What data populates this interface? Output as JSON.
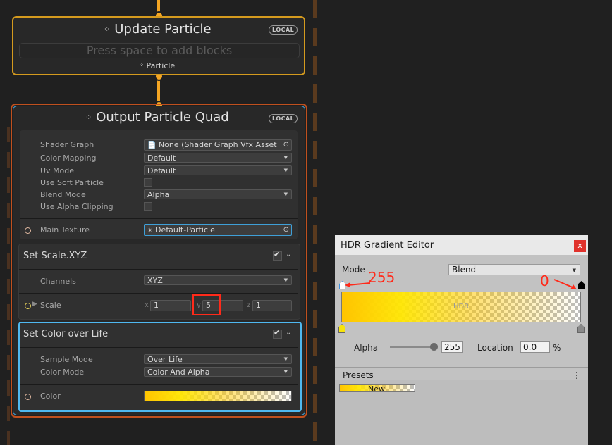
{
  "update_context": {
    "title": "Update Particle",
    "badge": "LOCAL",
    "placeholder": "Press space to add blocks",
    "footer": "Particle"
  },
  "output_context": {
    "title": "Output Particle Quad",
    "badge": "LOCAL",
    "settings": [
      {
        "label": "Shader Graph",
        "value": "None (Shader Graph Vfx Asset"
      },
      {
        "label": "Color Mapping",
        "value": "Default"
      },
      {
        "label": "Uv Mode",
        "value": "Default"
      },
      {
        "label": "Use Soft Particle",
        "value": ""
      },
      {
        "label": "Blend Mode",
        "value": "Alpha"
      },
      {
        "label": "Use Alpha Clipping",
        "value": ""
      }
    ],
    "main_texture": {
      "label": "Main Texture",
      "value": "Default-Particle"
    }
  },
  "set_scale": {
    "title": "Set Scale.XYZ",
    "channels_label": "Channels",
    "channels_value": "XYZ",
    "scale_label": "Scale",
    "x_label": "x",
    "x_value": "1",
    "y_label": "y",
    "y_value": "5",
    "z_label": "z",
    "z_value": "1"
  },
  "set_color": {
    "title": "Set Color over Life",
    "sample_mode_label": "Sample Mode",
    "sample_mode_value": "Over Life",
    "color_mode_label": "Color Mode",
    "color_mode_value": "Color And Alpha",
    "color_label": "Color"
  },
  "hdr_editor": {
    "title": "HDR Gradient Editor",
    "close": "x",
    "mode_label": "Mode",
    "mode_value": "Blend",
    "annotation_left": "255",
    "annotation_right": "0",
    "gradient_watermark": "HDR",
    "alpha_label": "Alpha",
    "alpha_value": "255",
    "alpha_slider": 1.0,
    "location_label": "Location",
    "location_value": "0.0",
    "location_unit": "%",
    "presets_label": "Presets",
    "presets_menu": "⋮",
    "preset_new": "New"
  },
  "colors": {
    "wire": "#f5a623",
    "highlight_box": "#ff2a1a",
    "selected_block_border": "#4fb8f0"
  }
}
